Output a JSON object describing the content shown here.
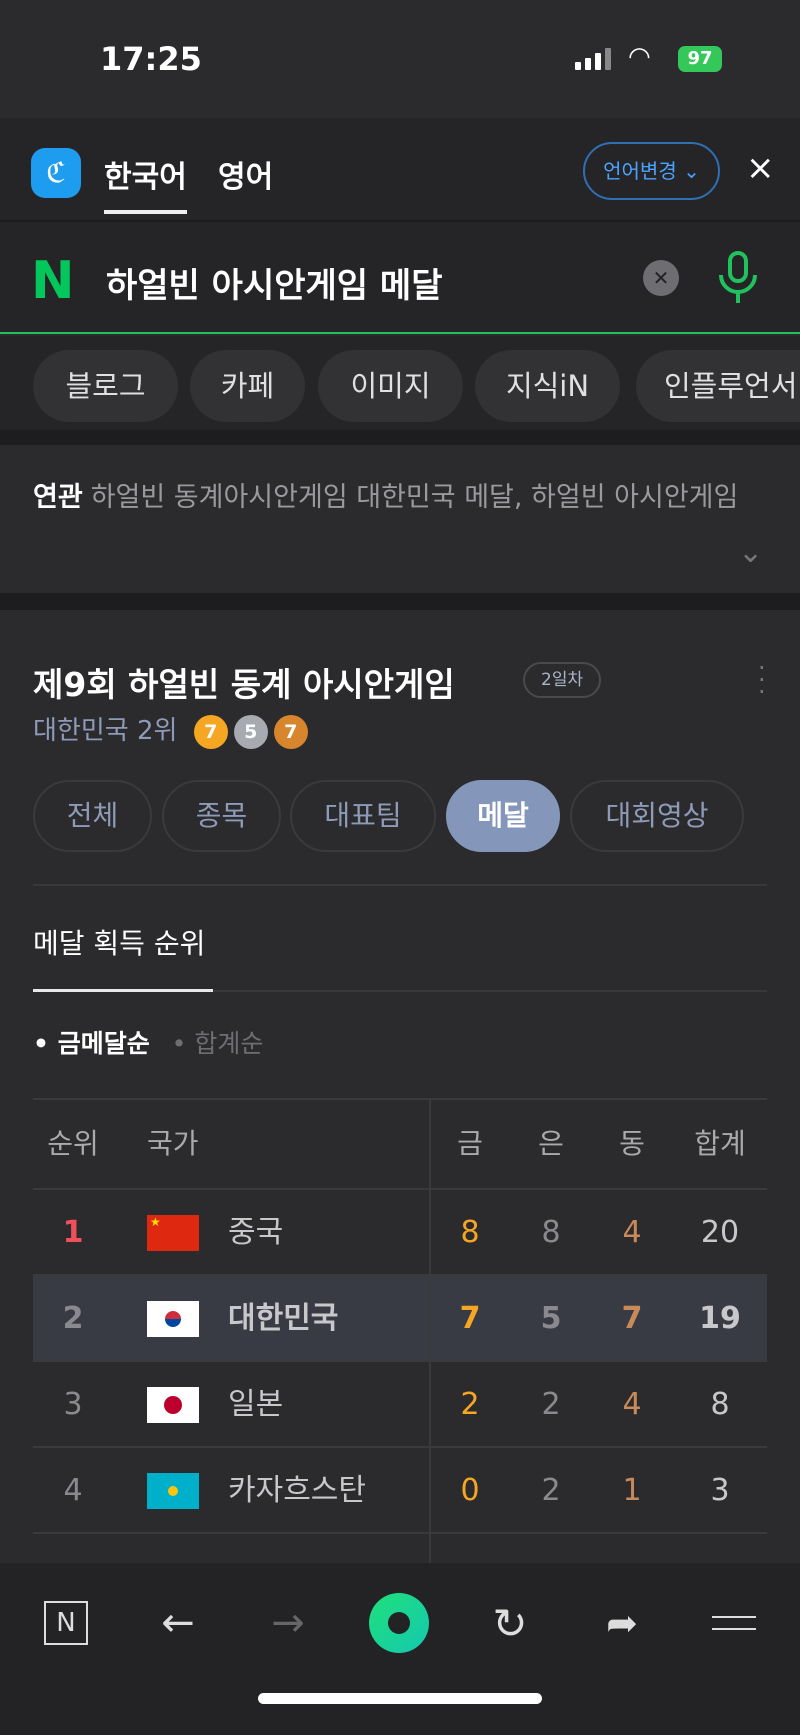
{
  "status_bar": {
    "time": "17:25",
    "battery": "97"
  },
  "header": {
    "tabs": [
      {
        "label": "한국어",
        "active": true
      },
      {
        "label": "영어",
        "active": false
      }
    ],
    "language_change": "언어변경",
    "close": "×"
  },
  "search": {
    "query": "하얼빈 아시안게임 메달"
  },
  "chips": [
    "블로그",
    "카페",
    "이미지",
    "지식iN",
    "인플루언서"
  ],
  "related": {
    "label": "연관",
    "text": "하얼빈 동계아시안게임 대한민국 메달, 하얼빈 아시안게임"
  },
  "card": {
    "title": "제9회 하얼빈 동계 아시안게임",
    "day_badge": "2일차",
    "subtitle": "대한민국 2위",
    "medals": {
      "gold": "7",
      "silver": "5",
      "bronze": "7"
    },
    "tabs": [
      {
        "label": "전체"
      },
      {
        "label": "종목"
      },
      {
        "label": "대표팀"
      },
      {
        "label": "메달",
        "active": true
      },
      {
        "label": "대회영상"
      }
    ],
    "section_title": "메달 획득 순위",
    "sort": [
      {
        "label": "금메달순",
        "active": true
      },
      {
        "label": "합계순",
        "active": false
      }
    ],
    "table": {
      "headers": [
        "순위",
        "국가",
        "금",
        "은",
        "동",
        "합계"
      ],
      "rows": [
        {
          "rank": "1",
          "country": "중국",
          "flag": "china",
          "gold": "8",
          "silver": "8",
          "bronze": "4",
          "total": "20"
        },
        {
          "rank": "2",
          "country": "대한민국",
          "flag": "korea",
          "gold": "7",
          "silver": "5",
          "bronze": "7",
          "total": "19",
          "highlight": true
        },
        {
          "rank": "3",
          "country": "일본",
          "flag": "japan",
          "gold": "2",
          "silver": "2",
          "bronze": "4",
          "total": "8"
        },
        {
          "rank": "4",
          "country": "카자흐스탄",
          "flag": "kazakhstan",
          "gold": "0",
          "silver": "2",
          "bronze": "1",
          "total": "3"
        }
      ]
    }
  },
  "colors": {
    "naver_green": "#03c75a",
    "gold": "#f5a623",
    "bronze": "#c98a5a",
    "rank1": "#f0505a",
    "accent_blue": "#4aa3ff"
  }
}
